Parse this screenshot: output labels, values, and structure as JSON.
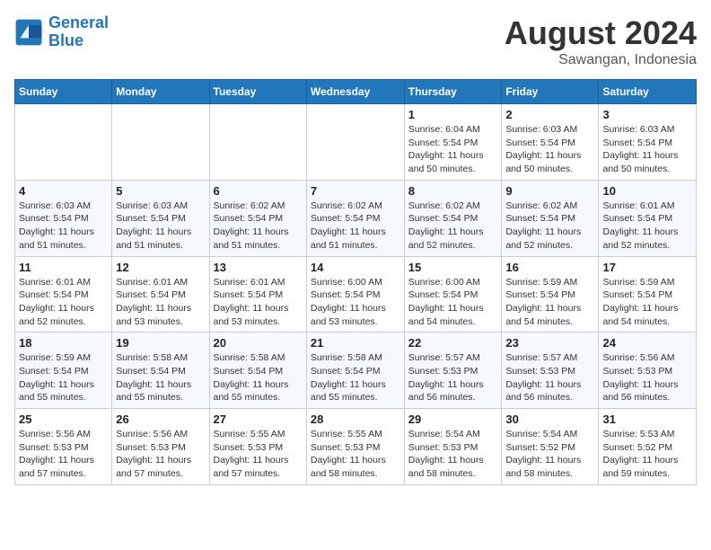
{
  "header": {
    "logo_line1": "General",
    "logo_line2": "Blue",
    "month": "August 2024",
    "location": "Sawangan, Indonesia"
  },
  "days_of_week": [
    "Sunday",
    "Monday",
    "Tuesday",
    "Wednesday",
    "Thursday",
    "Friday",
    "Saturday"
  ],
  "weeks": [
    [
      {
        "day": "",
        "info": ""
      },
      {
        "day": "",
        "info": ""
      },
      {
        "day": "",
        "info": ""
      },
      {
        "day": "",
        "info": ""
      },
      {
        "day": "1",
        "info": "Sunrise: 6:04 AM\nSunset: 5:54 PM\nDaylight: 11 hours\nand 50 minutes."
      },
      {
        "day": "2",
        "info": "Sunrise: 6:03 AM\nSunset: 5:54 PM\nDaylight: 11 hours\nand 50 minutes."
      },
      {
        "day": "3",
        "info": "Sunrise: 6:03 AM\nSunset: 5:54 PM\nDaylight: 11 hours\nand 50 minutes."
      }
    ],
    [
      {
        "day": "4",
        "info": "Sunrise: 6:03 AM\nSunset: 5:54 PM\nDaylight: 11 hours\nand 51 minutes."
      },
      {
        "day": "5",
        "info": "Sunrise: 6:03 AM\nSunset: 5:54 PM\nDaylight: 11 hours\nand 51 minutes."
      },
      {
        "day": "6",
        "info": "Sunrise: 6:02 AM\nSunset: 5:54 PM\nDaylight: 11 hours\nand 51 minutes."
      },
      {
        "day": "7",
        "info": "Sunrise: 6:02 AM\nSunset: 5:54 PM\nDaylight: 11 hours\nand 51 minutes."
      },
      {
        "day": "8",
        "info": "Sunrise: 6:02 AM\nSunset: 5:54 PM\nDaylight: 11 hours\nand 52 minutes."
      },
      {
        "day": "9",
        "info": "Sunrise: 6:02 AM\nSunset: 5:54 PM\nDaylight: 11 hours\nand 52 minutes."
      },
      {
        "day": "10",
        "info": "Sunrise: 6:01 AM\nSunset: 5:54 PM\nDaylight: 11 hours\nand 52 minutes."
      }
    ],
    [
      {
        "day": "11",
        "info": "Sunrise: 6:01 AM\nSunset: 5:54 PM\nDaylight: 11 hours\nand 52 minutes."
      },
      {
        "day": "12",
        "info": "Sunrise: 6:01 AM\nSunset: 5:54 PM\nDaylight: 11 hours\nand 53 minutes."
      },
      {
        "day": "13",
        "info": "Sunrise: 6:01 AM\nSunset: 5:54 PM\nDaylight: 11 hours\nand 53 minutes."
      },
      {
        "day": "14",
        "info": "Sunrise: 6:00 AM\nSunset: 5:54 PM\nDaylight: 11 hours\nand 53 minutes."
      },
      {
        "day": "15",
        "info": "Sunrise: 6:00 AM\nSunset: 5:54 PM\nDaylight: 11 hours\nand 54 minutes."
      },
      {
        "day": "16",
        "info": "Sunrise: 5:59 AM\nSunset: 5:54 PM\nDaylight: 11 hours\nand 54 minutes."
      },
      {
        "day": "17",
        "info": "Sunrise: 5:59 AM\nSunset: 5:54 PM\nDaylight: 11 hours\nand 54 minutes."
      }
    ],
    [
      {
        "day": "18",
        "info": "Sunrise: 5:59 AM\nSunset: 5:54 PM\nDaylight: 11 hours\nand 55 minutes."
      },
      {
        "day": "19",
        "info": "Sunrise: 5:58 AM\nSunset: 5:54 PM\nDaylight: 11 hours\nand 55 minutes."
      },
      {
        "day": "20",
        "info": "Sunrise: 5:58 AM\nSunset: 5:54 PM\nDaylight: 11 hours\nand 55 minutes."
      },
      {
        "day": "21",
        "info": "Sunrise: 5:58 AM\nSunset: 5:54 PM\nDaylight: 11 hours\nand 55 minutes."
      },
      {
        "day": "22",
        "info": "Sunrise: 5:57 AM\nSunset: 5:53 PM\nDaylight: 11 hours\nand 56 minutes."
      },
      {
        "day": "23",
        "info": "Sunrise: 5:57 AM\nSunset: 5:53 PM\nDaylight: 11 hours\nand 56 minutes."
      },
      {
        "day": "24",
        "info": "Sunrise: 5:56 AM\nSunset: 5:53 PM\nDaylight: 11 hours\nand 56 minutes."
      }
    ],
    [
      {
        "day": "25",
        "info": "Sunrise: 5:56 AM\nSunset: 5:53 PM\nDaylight: 11 hours\nand 57 minutes."
      },
      {
        "day": "26",
        "info": "Sunrise: 5:56 AM\nSunset: 5:53 PM\nDaylight: 11 hours\nand 57 minutes."
      },
      {
        "day": "27",
        "info": "Sunrise: 5:55 AM\nSunset: 5:53 PM\nDaylight: 11 hours\nand 57 minutes."
      },
      {
        "day": "28",
        "info": "Sunrise: 5:55 AM\nSunset: 5:53 PM\nDaylight: 11 hours\nand 58 minutes."
      },
      {
        "day": "29",
        "info": "Sunrise: 5:54 AM\nSunset: 5:53 PM\nDaylight: 11 hours\nand 58 minutes."
      },
      {
        "day": "30",
        "info": "Sunrise: 5:54 AM\nSunset: 5:52 PM\nDaylight: 11 hours\nand 58 minutes."
      },
      {
        "day": "31",
        "info": "Sunrise: 5:53 AM\nSunset: 5:52 PM\nDaylight: 11 hours\nand 59 minutes."
      }
    ]
  ]
}
